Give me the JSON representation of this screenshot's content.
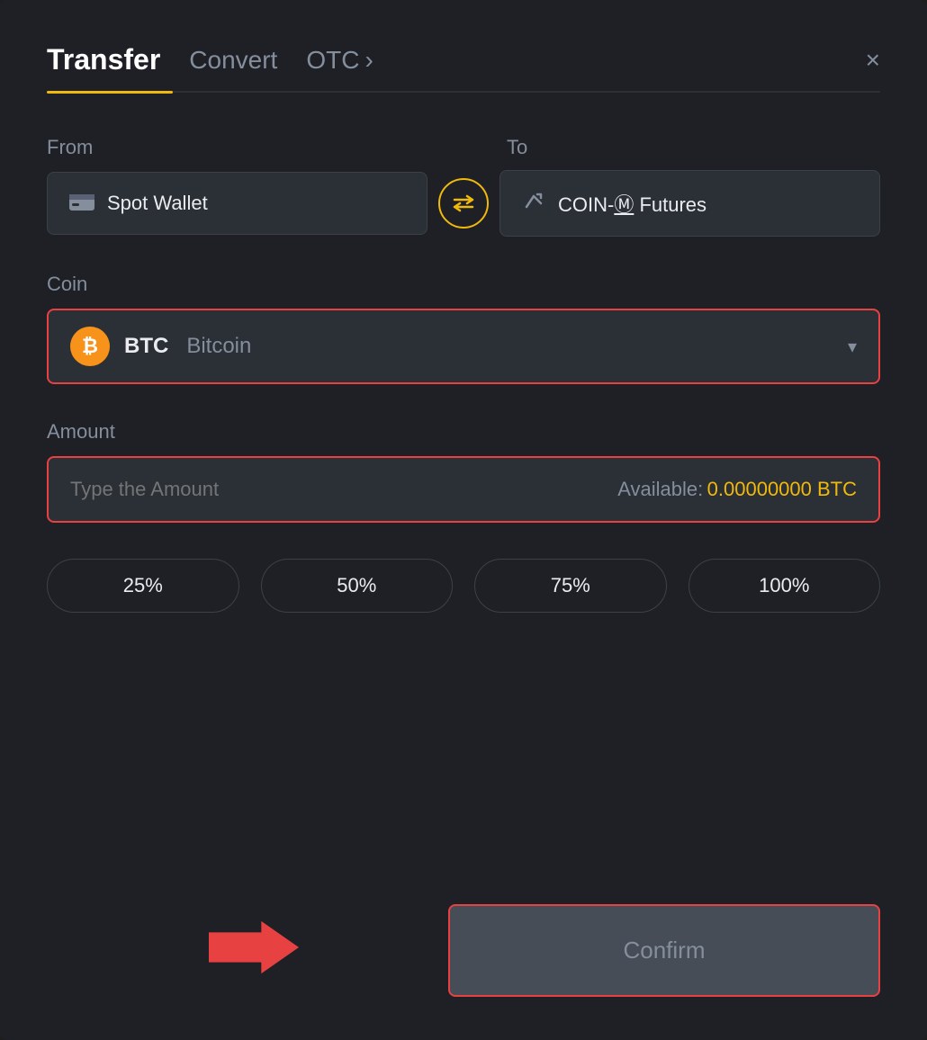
{
  "header": {
    "tab_transfer": "Transfer",
    "tab_convert": "Convert",
    "tab_otc": "OTC",
    "tab_otc_chevron": "›",
    "close_label": "×"
  },
  "from": {
    "label": "From",
    "wallet_icon": "▬",
    "wallet_name": "Spot Wallet"
  },
  "to": {
    "label": "To",
    "wallet_icon": "↑",
    "wallet_name": "COIN-M Futures"
  },
  "swap": {
    "icon": "⇄"
  },
  "coin": {
    "label": "Coin",
    "symbol": "BTC",
    "full_name": "Bitcoin",
    "chevron": "▾"
  },
  "amount": {
    "label": "Amount",
    "placeholder": "Type the Amount",
    "available_label": "Available:",
    "available_value": "0.00000000 BTC"
  },
  "percentages": [
    {
      "label": "25%"
    },
    {
      "label": "50%"
    },
    {
      "label": "75%"
    },
    {
      "label": "100%"
    }
  ],
  "confirm": {
    "label": "Confirm"
  }
}
